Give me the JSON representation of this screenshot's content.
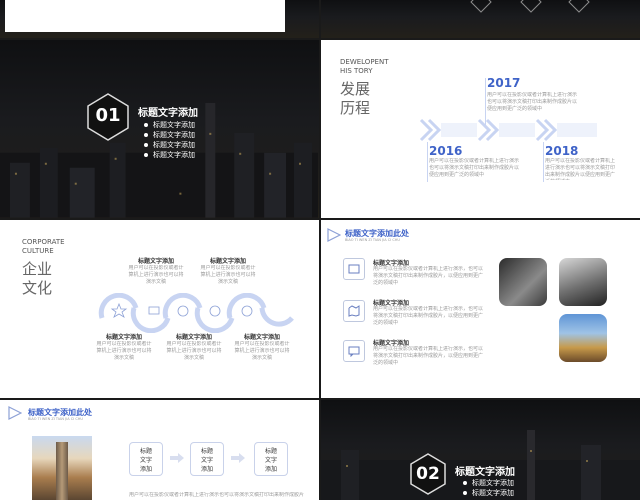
{
  "slides": {
    "s2": {
      "number": "01",
      "title": "标题文字添加",
      "bullets": [
        "标题文字添加",
        "标题文字添加",
        "标题文字添加",
        "标题文字添加"
      ]
    },
    "s3": {
      "en_line1": "DEWELOPENT",
      "en_line2": "HIS TORY",
      "cn_line1": "发展",
      "cn_line2": "历程",
      "years": [
        "2017",
        "2016",
        "2018"
      ],
      "desc": "用户可以在投影仪或者计算机上进行演示也可以将演示文稿打印出来制作成胶片以便应用到更广泛的领域中"
    },
    "s4": {
      "en_line1": "CORPORATE",
      "en_line2": "CULTURE",
      "cn_line1": "企业",
      "cn_line2": "文化",
      "item_title": "标题文字添加",
      "item_desc": "用户可以在投影仪或者计算机上进行演示也可以将演示文稿"
    },
    "s5": {
      "header": "标题文字添加此处",
      "sub": "BIAO TI WEN ZI TIAN JIA CI CHU",
      "item_title": "标题文字添加",
      "item_desc": "用户可以在投影仪或者计算机上进行演示，也可以将演示文稿打印出来制作成胶片，以便应用到更广泛的领域中"
    },
    "s6": {
      "header": "标题文字添加此处",
      "sub": "BIAO TI WEN ZI TIAN JIA CI CHU",
      "steps": [
        [
          "标题",
          "文字",
          "添加"
        ],
        [
          "标题",
          "文字",
          "添加"
        ],
        [
          "标题",
          "文字",
          "添加"
        ]
      ],
      "desc": "用户可以在投影仪或者计算机上进行演示也可以将演示文稿打印出来制作成胶片"
    },
    "s7": {
      "number": "02",
      "title": "标题文字添加",
      "bullets": [
        "标题文字添加",
        "标题文字添加"
      ]
    }
  },
  "colors": {
    "accent": "#3f63c8",
    "chevron": "#c8d4f2"
  }
}
